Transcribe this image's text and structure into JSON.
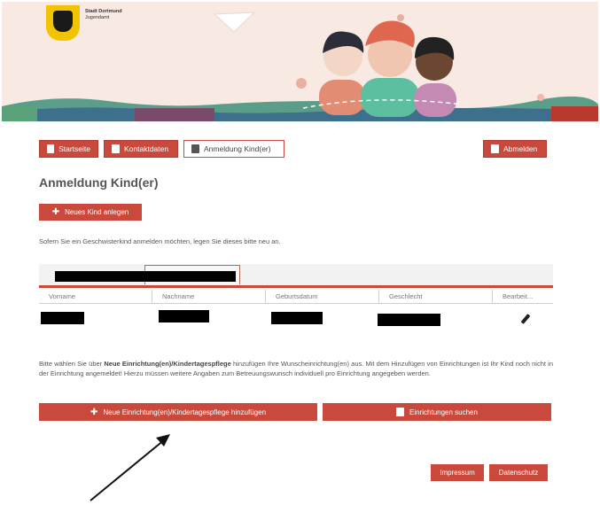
{
  "header": {
    "logo_title": "Stadt Dortmund",
    "logo_subtitle": "Jugendamt"
  },
  "nav": {
    "startseite": "Startseite",
    "kontaktdaten": "Kontaktdaten",
    "anmeldung": "Anmeldung Kind(er)",
    "abmelden": "Abmelden"
  },
  "page": {
    "title": "Anmeldung Kind(er)",
    "new_child_button": "Neues Kind anlegen",
    "hint": "Sofern Sie ein Geschwisterkind anmelden möchten, legen Sie dieses bitte neu an."
  },
  "table": {
    "headers": [
      "Vorname",
      "Nachname",
      "Geburtsdatum",
      "Geschlecht",
      "Bearbeit..."
    ]
  },
  "info": {
    "part1": "Bitte wählen Sie über ",
    "bold": "Neue Einrichtung(en)/Kindertagespflege",
    "part2": " hinzufügen Ihre Wunscheinrichtung(en) aus. Mit dem Hinzufügen von Einrichtungen ist Ihr Kind noch nicht in der Einrichtung angemeldet! Hierzu müssen weitere Angaben zum Betreuungswunsch individuell pro Einrichtung angegeben werden."
  },
  "actions": {
    "add_facility": "Neue Einrichtung(en)/Kindertagespflege hinzufügen",
    "search_facilities": "Einrichtungen suchen"
  },
  "footer": {
    "impressum": "Impressum",
    "datenschutz": "Datenschutz"
  },
  "colors": {
    "accent": "#c94a3c",
    "banner_bg": "#f8e9e2"
  }
}
